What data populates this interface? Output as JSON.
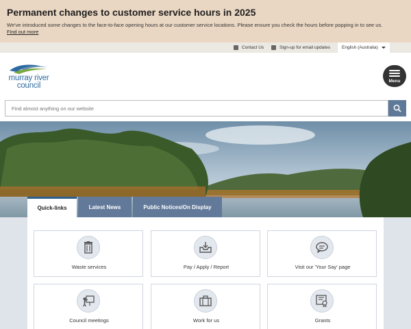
{
  "alert": {
    "title": "Permanent changes to customer service hours in 2025",
    "message": "We've introduced some changes to the face-to-face opening hours at our customer service locations. Please ensure you check the hours before popping in to see us.",
    "link": "Find out more"
  },
  "utility": {
    "contact": "Contact Us",
    "signup": "Sign-up for email updates",
    "language": "English (Australia)"
  },
  "header": {
    "logo_line1": "murray river",
    "logo_line2": "council",
    "menu_label": "Menu"
  },
  "search": {
    "placeholder": "Find almost anything on our website"
  },
  "tabs": [
    {
      "label": "Quick-links",
      "active": true
    },
    {
      "label": "Latest News",
      "active": false
    },
    {
      "label": "Public Notices/On Display",
      "active": false
    }
  ],
  "quicklinks": [
    {
      "label": "Waste services",
      "icon": "trash-bin-icon"
    },
    {
      "label": "Pay / Apply / Report",
      "icon": "inbox-tray-icon"
    },
    {
      "label": "Visit our 'Your Say' page",
      "icon": "speech-bubble-icon"
    },
    {
      "label": "Council meetings",
      "icon": "presentation-icon"
    },
    {
      "label": "Work for us",
      "icon": "briefcase-icon"
    },
    {
      "label": "Grants",
      "icon": "certificate-icon"
    }
  ],
  "colors": {
    "alert_bg": "#ead7c3",
    "tab_inactive": "#62799a",
    "brand_blue": "#2d6aa0",
    "search_button": "#5f7a99"
  }
}
